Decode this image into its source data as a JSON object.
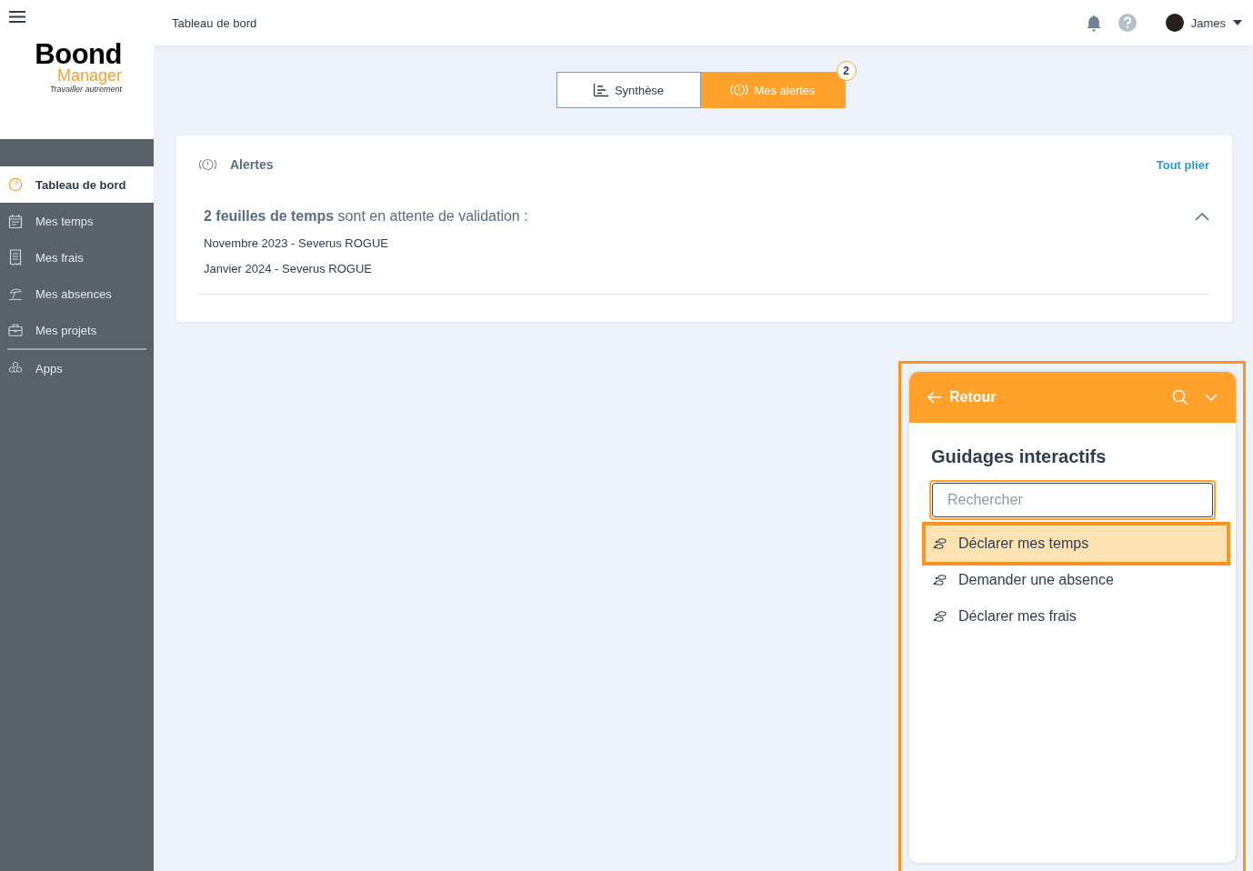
{
  "topbar": {
    "title": "Tableau de bord",
    "user": "James"
  },
  "logo": {
    "name": "Boond",
    "subtitle": "Manager",
    "tagline": "Travailler autrement"
  },
  "sidebar": {
    "items": [
      {
        "label": "Tableau de bord",
        "kind": "dashboard",
        "selected": true
      },
      {
        "label": "Mes temps",
        "kind": "times",
        "selected": false
      },
      {
        "label": "Mes frais",
        "kind": "expenses",
        "selected": false
      },
      {
        "label": "Mes absences",
        "kind": "absences",
        "selected": false
      },
      {
        "label": "Mes projets",
        "kind": "projects",
        "selected": false
      },
      {
        "label": "Apps",
        "kind": "apps",
        "selected": false
      }
    ]
  },
  "tabs": [
    {
      "label": "Synthèse",
      "kind": "summary",
      "selected": false
    },
    {
      "label": "Mes alertes",
      "kind": "alerts",
      "selected": true,
      "badge": "2"
    }
  ],
  "alerts": {
    "title": "Alertes",
    "collapse_label": "Tout plier",
    "groups": [
      {
        "heading": "**2 feuilles de temps** sont en attente de validation :",
        "expanded": true,
        "items": [
          "Novembre 2023 - Severus ROGUE",
          "Janvier 2024 - Severus ROGUE"
        ]
      }
    ]
  },
  "guide_panel": {
    "back_label": "Retour",
    "title": "Guidages interactifs",
    "search": {
      "placeholder": "Rechercher"
    },
    "items": [
      {
        "label": "Déclarer mes temps",
        "selected": true
      },
      {
        "label": "Demander une absence",
        "selected": false
      },
      {
        "label": "Déclarer mes frais",
        "selected": false
      }
    ]
  }
}
